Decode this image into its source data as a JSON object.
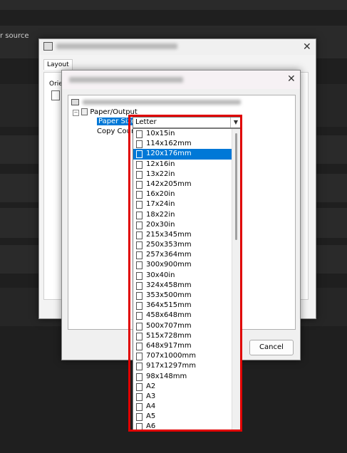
{
  "background": {
    "partial_label": "r source"
  },
  "outer_dialog": {
    "tab_label": "Layout",
    "orientation_label": "Orie"
  },
  "inner_dialog": {
    "tree": {
      "paper_output": "Paper/Output",
      "paper_size": "Paper Size:",
      "copy_count": "Copy Coun"
    },
    "cancel_label": "Cancel"
  },
  "paper_size_combo": {
    "value": "Letter",
    "options": [
      "10x15in",
      "114x162mm",
      "120x176mm",
      "12x16in",
      "13x22in",
      "142x205mm",
      "16x20in",
      "17x24in",
      "18x22in",
      "20x30in",
      "215x345mm",
      "250x353mm",
      "257x364mm",
      "300x900mm",
      "30x40in",
      "324x458mm",
      "353x500mm",
      "364x515mm",
      "458x648mm",
      "500x707mm",
      "515x728mm",
      "648x917mm",
      "707x1000mm",
      "917x1297mm",
      "98x148mm",
      "A2",
      "A3",
      "A4",
      "A5",
      "A6"
    ],
    "selected": "120x176mm"
  },
  "colors": {
    "selection": "#0078d7",
    "highlight": "#e00000"
  }
}
